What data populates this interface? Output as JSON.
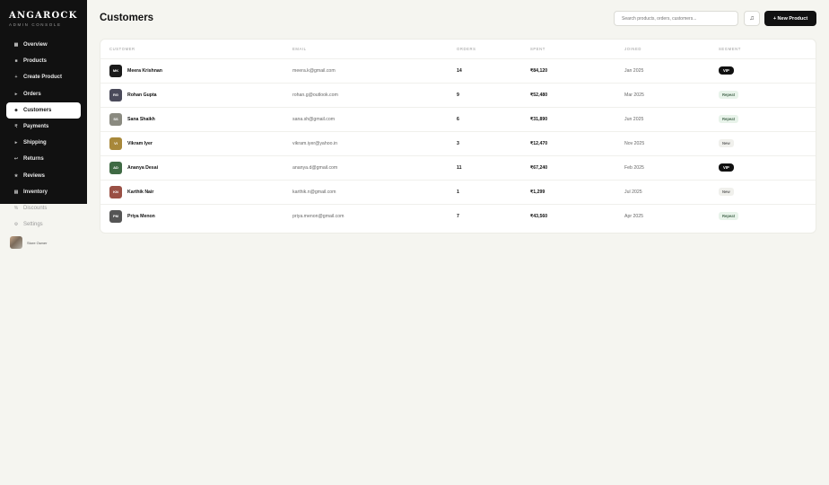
{
  "brand": {
    "name": "ANGAROCK",
    "sub": "ADMIN CONSOLE"
  },
  "nav": [
    {
      "label": "Overview",
      "icon": "▦",
      "icon_name": "grid-icon"
    },
    {
      "label": "Products",
      "icon": "■",
      "icon_name": "box-icon"
    },
    {
      "label": "Create Product",
      "icon": "+",
      "icon_name": "plus-icon"
    },
    {
      "label": "Orders",
      "icon": "▸",
      "icon_name": "orders-icon"
    },
    {
      "label": "Customers",
      "icon": "☻",
      "icon_name": "users-icon",
      "active": true
    },
    {
      "label": "Payments",
      "icon": "₹",
      "icon_name": "rupee-icon"
    },
    {
      "label": "Shipping",
      "icon": "▸",
      "icon_name": "truck-icon"
    },
    {
      "label": "Returns",
      "icon": "↩",
      "icon_name": "return-icon"
    },
    {
      "label": "Reviews",
      "icon": "★",
      "icon_name": "star-icon"
    },
    {
      "label": "Inventory",
      "icon": "▤",
      "icon_name": "inventory-icon"
    },
    {
      "label": "Discounts",
      "icon": "%",
      "icon_name": "percent-icon",
      "light": true
    },
    {
      "label": "Settings",
      "icon": "⚙",
      "icon_name": "gear-icon",
      "light": true
    }
  ],
  "user": {
    "name": "Store Owner"
  },
  "header": {
    "title": "Customers",
    "search_placeholder": "Search products, orders, customers...",
    "new_button": "+ New Product"
  },
  "table": {
    "columns": [
      "CUSTOMER",
      "EMAIL",
      "ORDERS",
      "SPENT",
      "JOINED",
      "SEGMENT"
    ],
    "rows": [
      {
        "initials": "MK",
        "avatar_color": "#1a1a1a",
        "name": "Meera Krishnan",
        "email": "meera.k@gmail.com",
        "orders": "14",
        "spent": "₹84,120",
        "joined": "Jan 2025",
        "segment": "VIP",
        "segment_type": "vip"
      },
      {
        "initials": "RG",
        "avatar_color": "#4a4a5a",
        "name": "Rohan Gupta",
        "email": "rohan.g@outlook.com",
        "orders": "9",
        "spent": "₹52,480",
        "joined": "Mar 2025",
        "segment": "Repeat",
        "segment_type": "repeat"
      },
      {
        "initials": "SS",
        "avatar_color": "#8a8a80",
        "name": "Sana Shaikh",
        "email": "sana.sh@gmail.com",
        "orders": "6",
        "spent": "₹31,890",
        "joined": "Jun 2025",
        "segment": "Repeat",
        "segment_type": "repeat"
      },
      {
        "initials": "VI",
        "avatar_color": "#a8883a",
        "name": "Vikram Iyer",
        "email": "vikram.iyer@yahoo.in",
        "orders": "3",
        "spent": "₹12,470",
        "joined": "Nov 2025",
        "segment": "New",
        "segment_type": "new"
      },
      {
        "initials": "AD",
        "avatar_color": "#3f6a44",
        "name": "Ananya Desai",
        "email": "ananya.d@gmail.com",
        "orders": "11",
        "spent": "₹67,240",
        "joined": "Feb 2025",
        "segment": "VIP",
        "segment_type": "vip"
      },
      {
        "initials": "KN",
        "avatar_color": "#9a5045",
        "name": "Karthik Nair",
        "email": "karthik.n@gmail.com",
        "orders": "1",
        "spent": "₹1,299",
        "joined": "Jul 2025",
        "segment": "New",
        "segment_type": "new"
      },
      {
        "initials": "PM",
        "avatar_color": "#555555",
        "name": "Priya Menon",
        "email": "priya.menon@gmail.com",
        "orders": "7",
        "spent": "₹43,560",
        "joined": "Apr 2025",
        "segment": "Repeat",
        "segment_type": "repeat"
      }
    ]
  }
}
